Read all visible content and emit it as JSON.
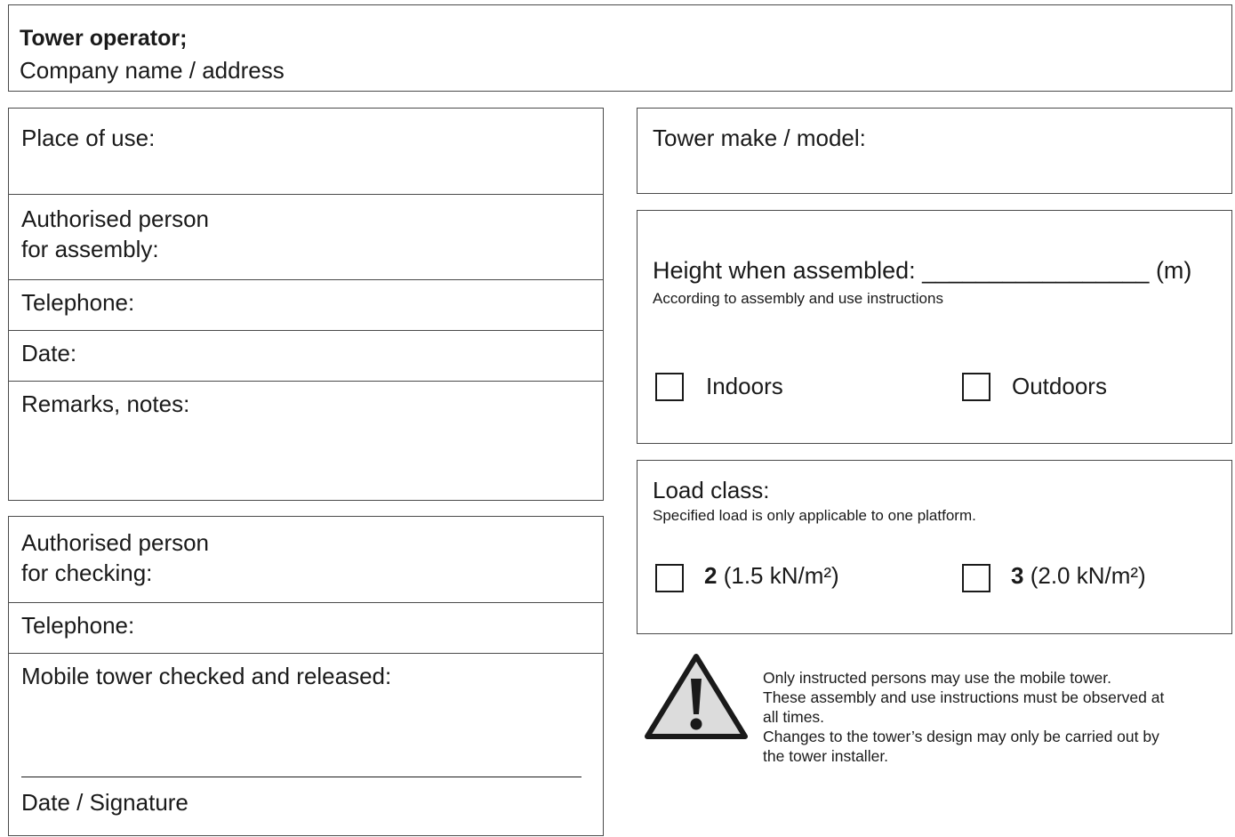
{
  "operator": {
    "title": "Tower operator;",
    "subtitle": "Company name / address"
  },
  "left_top": {
    "place_of_use": "Place of use:",
    "assembly_person_line1": "Authorised person",
    "assembly_person_line2": "for assembly:",
    "telephone": "Telephone:",
    "date": "Date:",
    "remarks": "Remarks, notes:"
  },
  "left_bottom": {
    "checking_person_line1": "Authorised person",
    "checking_person_line2": "for checking:",
    "telephone": "Telephone:",
    "checked_released": "Mobile tower checked and released:",
    "date_signature": "Date / Signature"
  },
  "tower_model": {
    "label": "Tower make / model:"
  },
  "height": {
    "label": "Height when assembled: _________________ (m)",
    "note": "According to assembly and use instructions",
    "options": [
      {
        "label": "Indoors",
        "checked": false
      },
      {
        "label": "Outdoors",
        "checked": false
      }
    ]
  },
  "load_class": {
    "label": "Load class:",
    "note": "Specified load is only applicable to one platform.",
    "options": [
      {
        "class": "2",
        "value": "(1.5 kN/m²)",
        "checked": false
      },
      {
        "class": "3",
        "value": "(2.0 kN/m²)",
        "checked": false
      }
    ]
  },
  "warning": {
    "icon": "warning-triangle-icon",
    "line1": "Only instructed persons may use the mobile tower.",
    "line2": "These assembly and use instructions must be observed at",
    "line3": "all times.",
    "line4": "Changes to the tower’s design may only be carried out by",
    "line5": "the tower installer."
  }
}
